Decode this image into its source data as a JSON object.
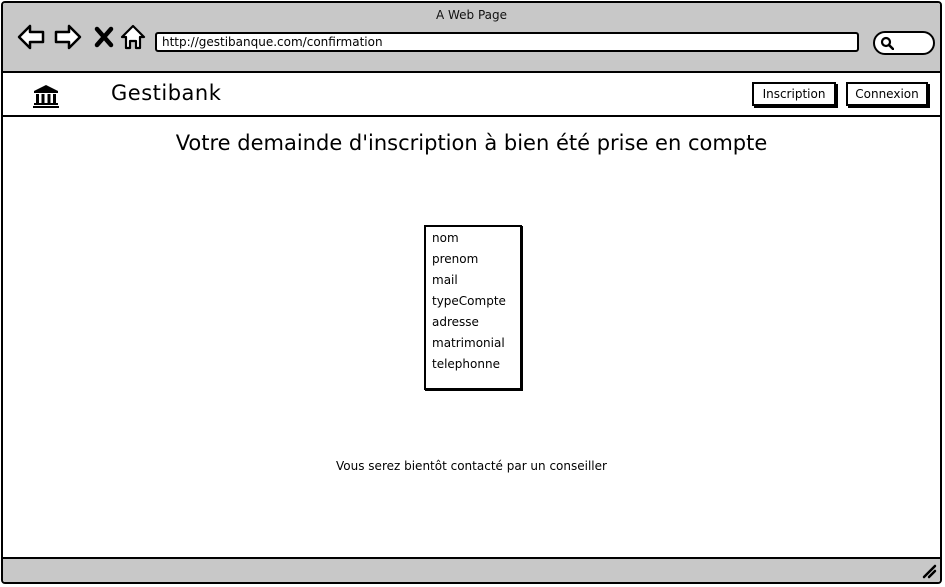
{
  "window": {
    "title": "A Web Page"
  },
  "browser": {
    "url": "http://gestibanque.com/confirmation",
    "icons": [
      "back-arrow-icon",
      "forward-arrow-icon",
      "close-x-icon",
      "home-icon",
      "search-icon"
    ]
  },
  "navbar": {
    "logo_icon": "bank-icon",
    "brand": "Gestibank",
    "inscription_label": "Inscription",
    "connexion_label": "Connexion"
  },
  "main": {
    "title": "Votre demainde d'inscription à bien été prise en compte",
    "fields": [
      "nom",
      "prenom",
      "mail",
      "typeCompte",
      "adresse",
      "matrimonial",
      "telephonne"
    ],
    "note": "Vous serez bientôt contacté par un conseiller"
  },
  "colors": {
    "chrome": "#c8c8c8",
    "border": "#000000",
    "background": "#ffffff"
  }
}
